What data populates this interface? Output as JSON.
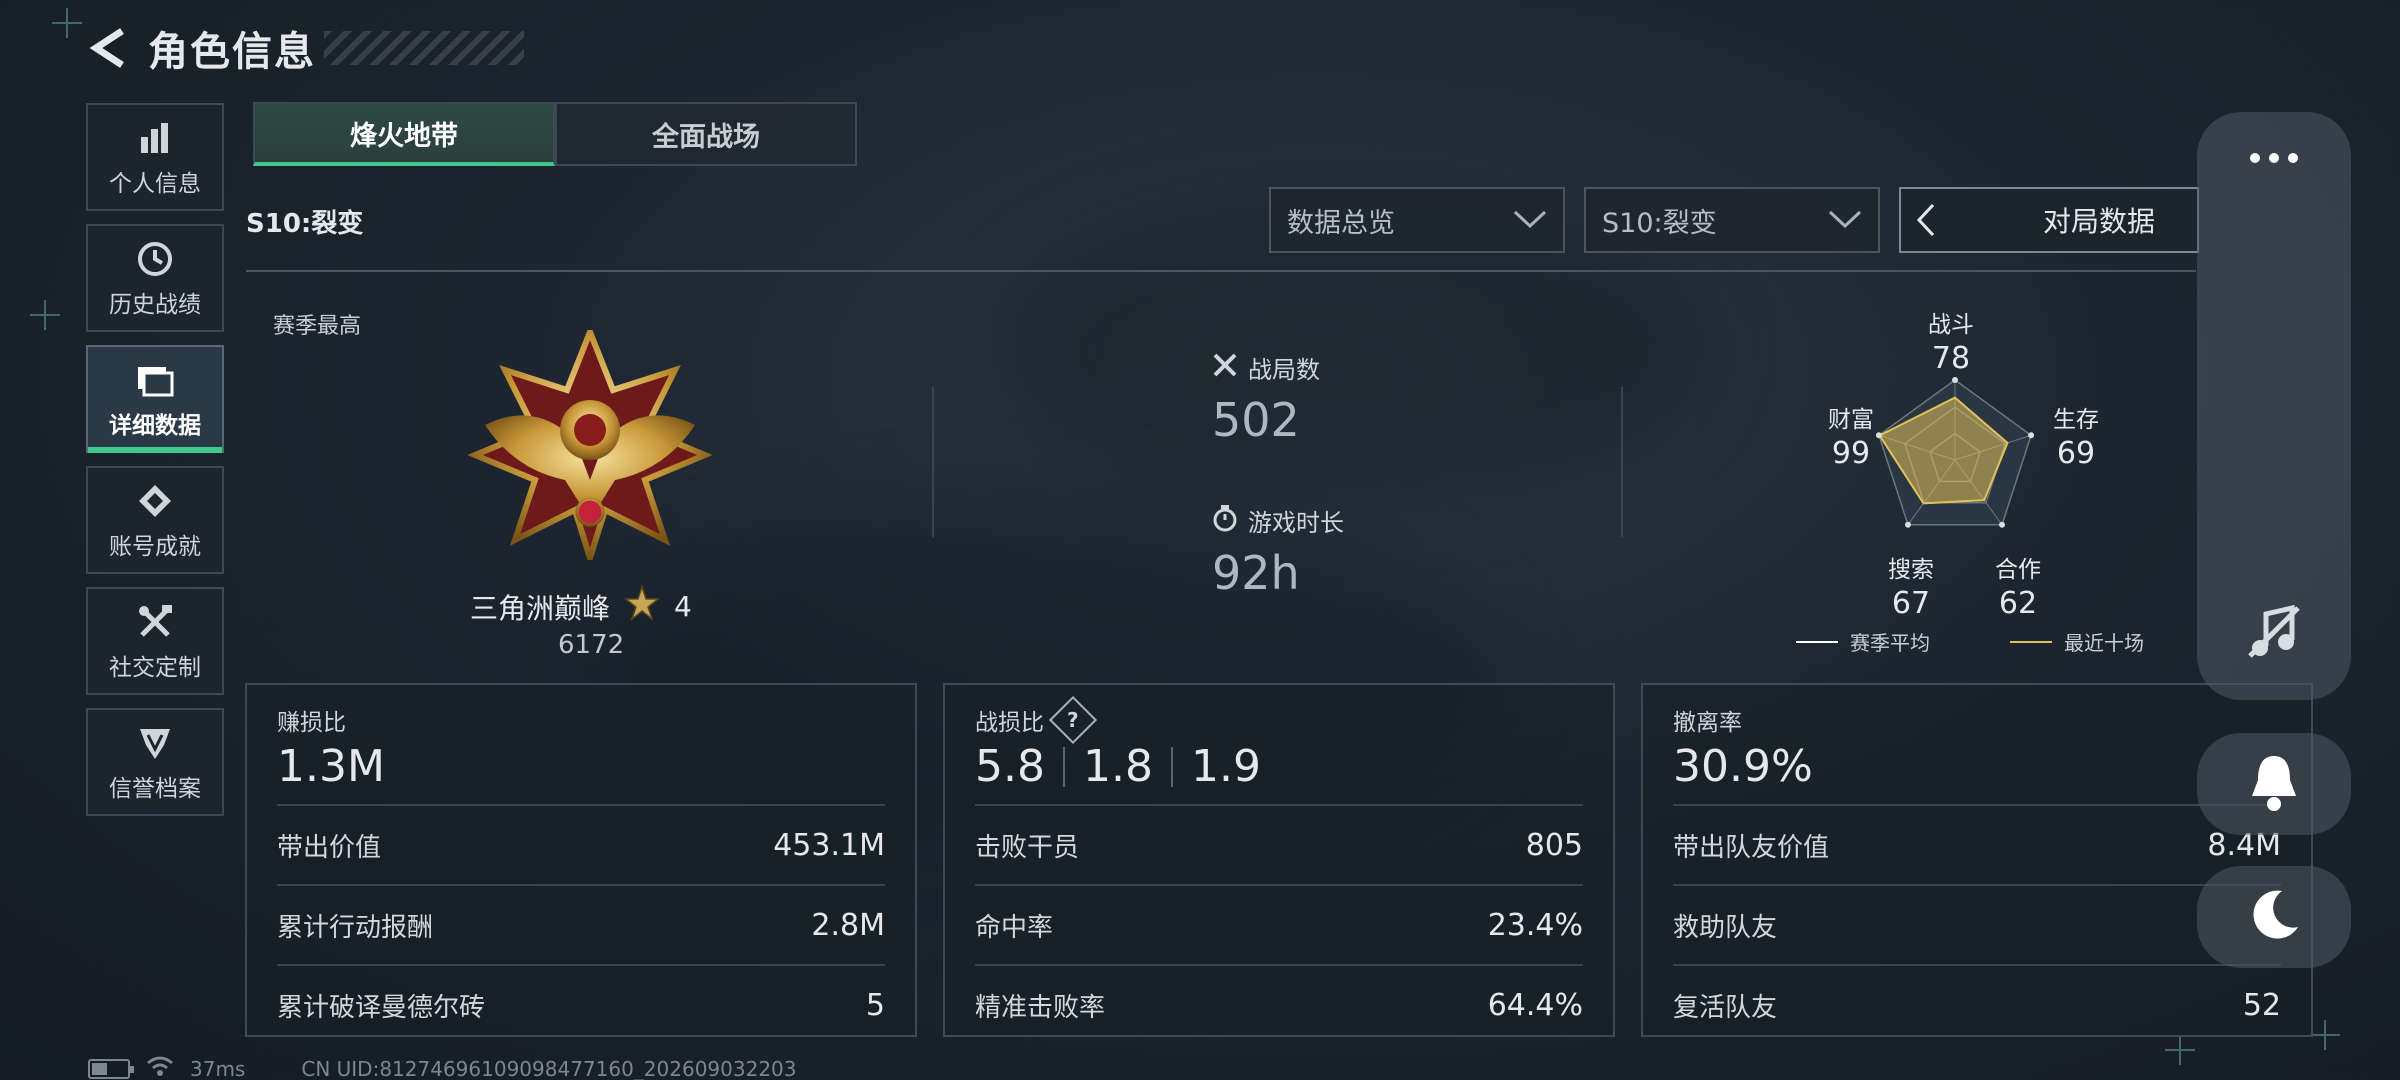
{
  "header": {
    "title": "角色信息"
  },
  "sidebar": {
    "items": [
      {
        "label": "个人信息",
        "icon": "bar-chart-icon"
      },
      {
        "label": "历史战绩",
        "icon": "history-icon"
      },
      {
        "label": "详细数据",
        "icon": "folder-icon",
        "active": true
      },
      {
        "label": "账号成就",
        "icon": "achievement-icon"
      },
      {
        "label": "社交定制",
        "icon": "tools-icon"
      },
      {
        "label": "信誉档案",
        "icon": "reputation-icon"
      }
    ]
  },
  "tabs": [
    {
      "label": "烽火地带",
      "active": true
    },
    {
      "label": "全面战场",
      "active": false
    }
  ],
  "season": {
    "title": "S10:裂变"
  },
  "filters": {
    "overview": "数据总览",
    "season": "S10:裂变",
    "match_data": "对局数据"
  },
  "summary": {
    "season_best_label": "赛季最高",
    "rank_name": "三角洲巅峰",
    "rank_stars": "4",
    "rank_score": "6172",
    "matches_label": "战局数",
    "matches_value": "502",
    "playtime_label": "游戏时长",
    "playtime_value": "92h"
  },
  "radar": {
    "axes": [
      {
        "label": "战斗",
        "value": "78"
      },
      {
        "label": "生存",
        "value": "69"
      },
      {
        "label": "合作",
        "value": "62"
      },
      {
        "label": "搜索",
        "value": "67"
      },
      {
        "label": "财富",
        "value": "99"
      }
    ],
    "legend_avg": "赛季平均",
    "legend_recent": "最近十场",
    "colors": {
      "avg": "#ffffff",
      "recent": "#e2c15a"
    }
  },
  "cards": {
    "profit": {
      "title": "赚损比",
      "value": "1.3M",
      "rows": [
        {
          "label": "带出价值",
          "value": "453.1M"
        },
        {
          "label": "累计行动报酬",
          "value": "2.8M"
        },
        {
          "label": "累计破译曼德尔砖",
          "value": "5"
        }
      ]
    },
    "kd": {
      "title": "战损比",
      "values": [
        "5.8",
        "1.8",
        "1.9"
      ],
      "rows": [
        {
          "label": "击败干员",
          "value": "805"
        },
        {
          "label": "命中率",
          "value": "23.4%"
        },
        {
          "label": "精准击败率",
          "value": "64.4%"
        }
      ]
    },
    "extract": {
      "title": "撤离率",
      "value": "30.9%",
      "rows": [
        {
          "label": "带出队友价值",
          "value": "8.4M"
        },
        {
          "label": "救助队友",
          "value": ""
        },
        {
          "label": "复活队友",
          "value": "52"
        }
      ]
    }
  },
  "status": {
    "ping": "37ms",
    "uid": "CN UID:81274696109098477160_202609032203"
  },
  "colors": {
    "accent": "#3fc98f",
    "radar_fill": "#e2c15a"
  }
}
